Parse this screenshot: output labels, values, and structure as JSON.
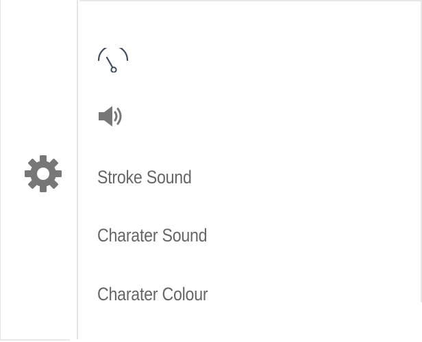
{
  "settings_rail": {
    "gear_icon": "gear-icon",
    "gear_color": "#777777"
  },
  "settings_menu": {
    "items": [
      {
        "type": "icon",
        "icon": "speed-gauge-icon",
        "color": "#3d4a5c"
      },
      {
        "type": "icon",
        "icon": "speaker-volume-icon",
        "color": "#777777"
      },
      {
        "type": "text",
        "label": "Stroke Sound"
      },
      {
        "type": "text",
        "label": "Charater Sound"
      },
      {
        "type": "text",
        "label": "Charater Colour"
      }
    ],
    "text_color": "#666666"
  }
}
